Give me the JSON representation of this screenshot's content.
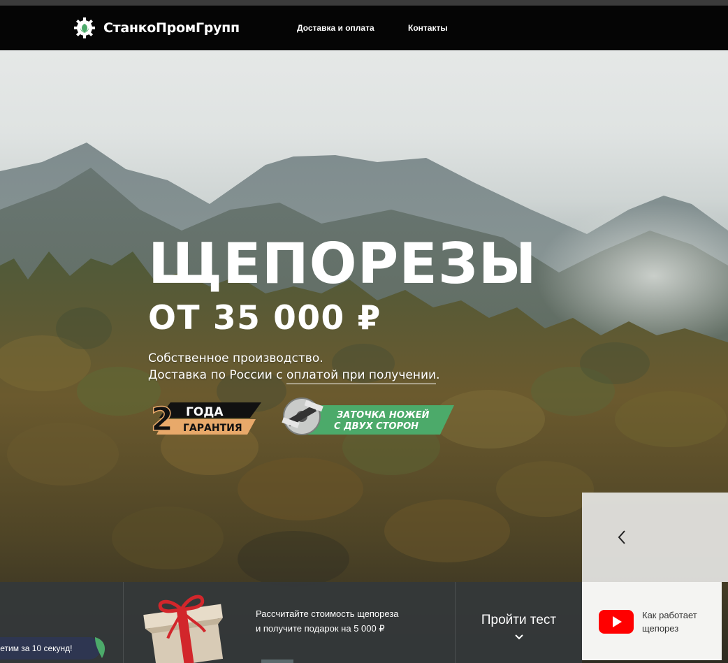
{
  "header": {
    "logo_text": "СтанкоПромГрупп",
    "nav": [
      {
        "label": "Доставка и оплата"
      },
      {
        "label": "Контакты"
      }
    ]
  },
  "hero": {
    "title": "ЩЕПОРЕЗЫ",
    "price": "ОТ 35 000 ₽",
    "subtitle_line1": "Собственное производство.",
    "subtitle_line2_prefix": "Доставка по России с ",
    "subtitle_line2_link": "оплатой при получении",
    "subtitle_line2_suffix": ".",
    "badge_warranty": {
      "number": "2",
      "line1": "ГОДА",
      "line2": "ГАРАНТИЯ"
    },
    "badge_sharpen": {
      "line1": "ЗАТОЧКА НОЖЕЙ",
      "line2": "С ДВУХ СТОРОН"
    }
  },
  "promo": {
    "calc_line1": "Рассчитайте стоимость щепореза",
    "calc_line2": "и получите подарок на 5 000 ₽",
    "test_button": "Пройти тест",
    "video_line1": "Как работает",
    "video_line2": "щепорез"
  },
  "chat": {
    "text": "ветим за 10 секунд!"
  },
  "colors": {
    "nav_bg": "#050505",
    "accent_green": "#4caa6a",
    "warranty_orange": "#e8a96a",
    "youtube_red": "#ff0000",
    "strip_bg": "#34383a",
    "chat_bg": "#2e3651"
  }
}
